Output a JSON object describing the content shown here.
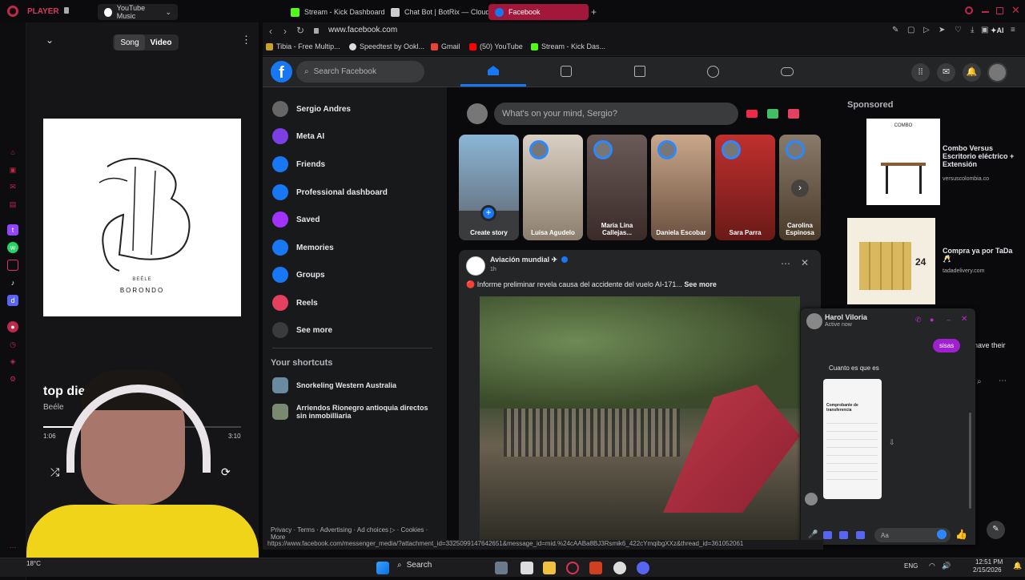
{
  "tabs": {
    "player_label": "PLAYER",
    "youtube_music": "YouTube Music",
    "kick": "Stream - Kick Dashboard",
    "botrix": "Chat Bot | BotRix — Cloud",
    "facebook": "Facebook"
  },
  "address": {
    "url": "www.facebook.com"
  },
  "bookmarks": [
    "Tibia - Free Multip...",
    "Speedtest by Ookl...",
    "Gmail",
    "(50) YouTube",
    "Stream - Kick Das..."
  ],
  "player": {
    "song_tab": "Song",
    "video_tab": "Video",
    "album_artist": "BEÉLE",
    "album_title": "BORONDO",
    "track_title": "top diesel",
    "artist": "Beéle",
    "elapsed": "1:06",
    "duration": "3:10"
  },
  "facebook": {
    "search_placeholder": "Search Facebook",
    "left_nav": [
      {
        "label": "Sergio Andres",
        "icon": "avatar-icon",
        "color": "#666"
      },
      {
        "label": "Meta AI",
        "icon": "meta-ai-icon",
        "color": "#7b3fe4"
      },
      {
        "label": "Friends",
        "icon": "friends-icon",
        "color": "#1877f2"
      },
      {
        "label": "Professional dashboard",
        "icon": "dashboard-icon",
        "color": "#1877f2"
      },
      {
        "label": "Saved",
        "icon": "bookmark-icon",
        "color": "#a033ff"
      },
      {
        "label": "Memories",
        "icon": "clock-icon",
        "color": "#1877f2"
      },
      {
        "label": "Groups",
        "icon": "groups-icon",
        "color": "#1877f2"
      },
      {
        "label": "Reels",
        "icon": "reels-icon",
        "color": "#e4405f"
      },
      {
        "label": "See more",
        "icon": "chevron-down-icon",
        "color": "#3a3b3c"
      }
    ],
    "shortcuts_title": "Your shortcuts",
    "shortcuts": [
      "Snorkeling Western Australia",
      "Arriendos Rionegro antioquia directos sin inmobilliaria"
    ],
    "footer": "Privacy · Terms · Advertising · Ad choices ▷ · Cookies · More",
    "composer_placeholder": "What's on your mind, Sergio?",
    "stories": [
      "Create story",
      "Luisa Agudelo",
      "Maria Lina Callejas...",
      "Daniela Escobar",
      "Sara Parra",
      "Carolina Espinosa"
    ],
    "post": {
      "page": "Aviación mundial ✈",
      "time": "1h",
      "text": "🔴 Informe preliminar revela causa del accidente del vuelo AI-171...",
      "see_more": "See more"
    },
    "sponsored_title": "Sponsored",
    "ads": [
      {
        "title": "Combo Versus Escritorio eléctrico + Extensión",
        "domain": "versuscolombia.co"
      },
      {
        "title": "Compra ya por TaDa 🥂",
        "domain": "tadadelivery.com"
      }
    ],
    "ad_image_text": "COMBO",
    "ad_can_text": "24",
    "partial_text": "have their"
  },
  "chat": {
    "name": "Harol Viloria",
    "status": "Active now",
    "sent_bubble": "sisas",
    "received_text": "Cuanto es que es",
    "receipt_title": "Comprobante de transferencia",
    "input_placeholder": "Aa"
  },
  "status_url": "https://www.facebook.com/messenger_media/?attachment_id=3325099147642651&message_id=mid.%24cAABa8BJ3Rsmik6_422cYmqibgXXz&thread_id=361052061",
  "taskbar": {
    "search": "Search",
    "lang": "ENG",
    "time": "12:51 PM",
    "date": "2/15/2026",
    "temp": "18°C"
  }
}
